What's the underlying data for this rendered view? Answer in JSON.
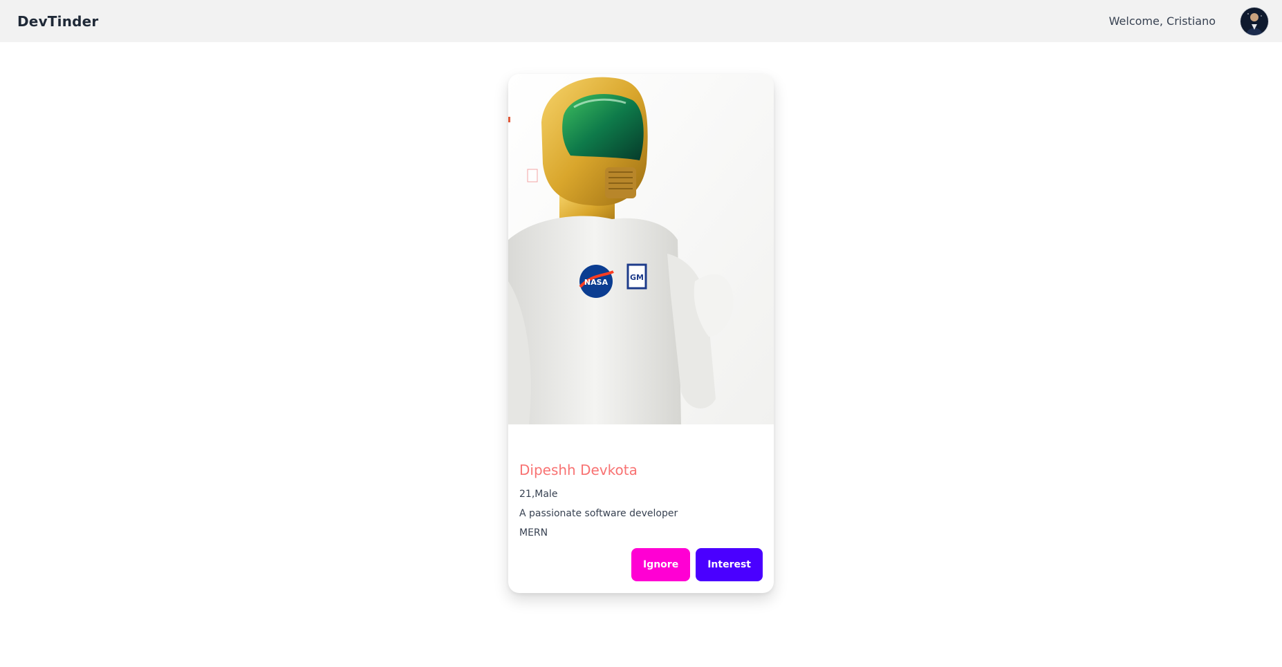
{
  "navbar": {
    "brand": "DevTinder",
    "welcome_text": "Welcome, Cristiano",
    "avatar_icon": "user-avatar"
  },
  "feed_card": {
    "photo_icon": "profile-photo",
    "name": "Dipeshh Devkota",
    "age_gender": "21,Male",
    "about": "A passionate software developer",
    "skills": "MERN",
    "ignore_label": "Ignore",
    "interest_label": "Interest"
  },
  "colors": {
    "navbar_bg": "#f2f2f2",
    "name_accent": "#f87272",
    "ignore_button": "#ff00d3",
    "interest_button": "#4a00ff"
  }
}
